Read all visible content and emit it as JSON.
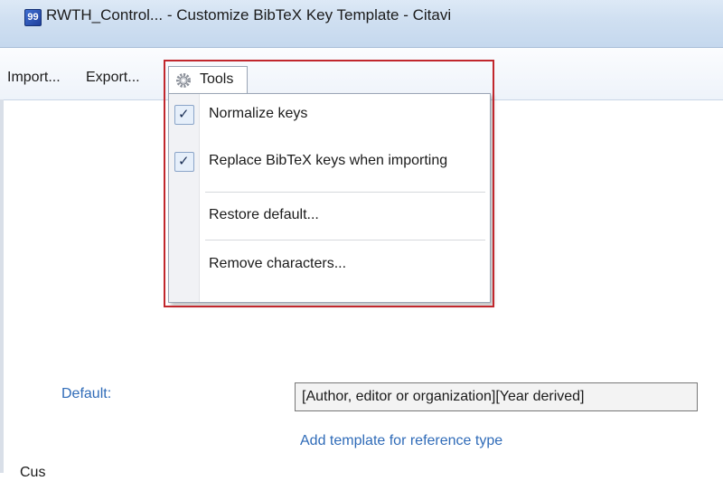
{
  "window": {
    "title": "RWTH_Control... - Customize BibTeX Key Template - Citavi",
    "app_icon": "citavi-logo-icon",
    "app_icon_glyph": "99"
  },
  "menubar": {
    "items": [
      {
        "label": "Import..."
      },
      {
        "label": "Export..."
      },
      {
        "label": "Tools",
        "icon": "gear-icon"
      }
    ]
  },
  "tools_menu": {
    "items": [
      {
        "label": "Normalize keys",
        "checked": true
      },
      {
        "label": "Replace BibTeX keys when importing",
        "checked": true
      },
      {
        "label": "Restore default...",
        "checked": false
      },
      {
        "label": "Remove characters...",
        "checked": false
      }
    ],
    "checkmark": "✓"
  },
  "content": {
    "default_label": "Default:",
    "default_value": "[Author, editor or organization][Year derived]",
    "add_template_link": "Add template for reference type",
    "cutoff_text": "Cus"
  },
  "colors": {
    "highlight": "#c1272d",
    "link": "#2f6bb8",
    "titlebar": "#cfdff1"
  }
}
